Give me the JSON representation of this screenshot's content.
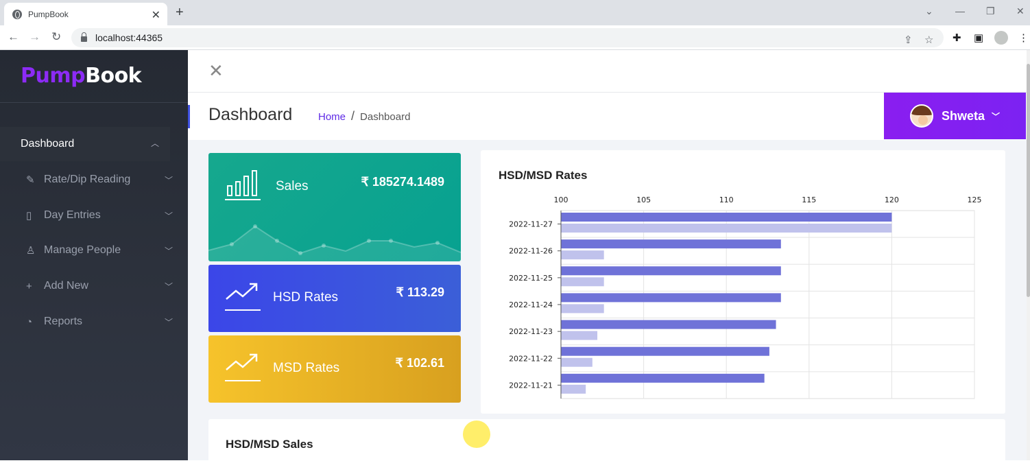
{
  "browser": {
    "tab_title": "PumpBook",
    "url": "localhost:44365"
  },
  "sidebar": {
    "logo_part1": "Pump",
    "logo_part2": "Book",
    "active_item": "Dashboard",
    "items": [
      {
        "label": "Rate/Dip Reading",
        "icon": "edit-icon"
      },
      {
        "label": "Day Entries",
        "icon": "book-icon"
      },
      {
        "label": "Manage People",
        "icon": "person-icon"
      },
      {
        "label": "Add New",
        "icon": "plus-icon"
      },
      {
        "label": "Reports",
        "icon": "pie-chart-icon"
      }
    ]
  },
  "header": {
    "page_title": "Dashboard",
    "breadcrumb_home": "Home",
    "breadcrumb_sep": "/",
    "breadcrumb_current": "Dashboard",
    "user_name": "Shweta"
  },
  "cards": {
    "sales": {
      "label": "Sales",
      "value": "₹ 185274.1489"
    },
    "hsd": {
      "label": "HSD Rates",
      "value": "₹ 113.29"
    },
    "msd": {
      "label": "MSD Rates",
      "value": "₹ 102.61"
    }
  },
  "colors": {
    "accent": "#8a1ef0",
    "sales_card": "#0ba58f",
    "hsd_card": "#3b4fe3",
    "msd_card": "#e8b225",
    "bar_primary": "#6f72d8",
    "bar_secondary": "#c0c2ec"
  },
  "chart_data": {
    "type": "bar",
    "orientation": "horizontal",
    "title": "HSD/MSD Rates",
    "xlim": [
      100,
      125
    ],
    "xticks": [
      "100",
      "105",
      "110",
      "115",
      "120",
      "125"
    ],
    "categories": [
      "2022-11-27",
      "2022-11-26",
      "2022-11-25",
      "2022-11-24",
      "2022-11-23",
      "2022-11-22",
      "2022-11-21"
    ],
    "series": [
      {
        "values": [
          120,
          113.3,
          113.3,
          113.3,
          113,
          112.6,
          112.3
        ]
      },
      {
        "values": [
          120,
          102.6,
          102.6,
          102.6,
          102.2,
          101.9,
          101.5
        ]
      }
    ],
    "grid": true
  },
  "sales_section": {
    "title": "HSD/MSD Sales"
  }
}
